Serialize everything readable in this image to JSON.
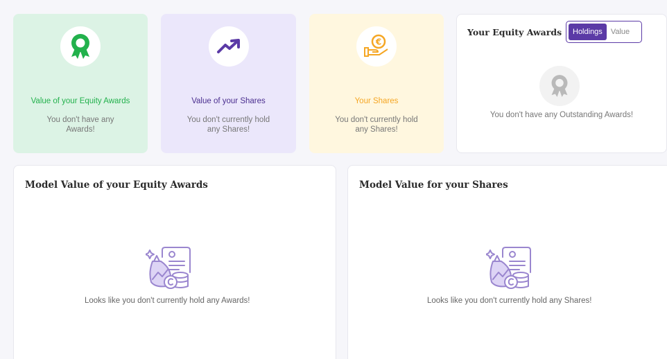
{
  "colors": {
    "green": "#22b14c",
    "purple": "#5b3aa6",
    "orange": "#f5a623",
    "grey": "#b9b9b9"
  },
  "cards": {
    "awards": {
      "title": "Value of your Equity Awards",
      "subtitle": "You don't have any Awards!",
      "icon": "ribbon-award-icon"
    },
    "shares": {
      "title": "Value of your Shares",
      "subtitle": "You don't currently hold any Shares!",
      "icon": "trending-up-icon"
    },
    "your_shares": {
      "title": "Your Shares",
      "subtitle": "You don't currently hold any Shares!",
      "icon": "hand-euro-coin-icon"
    }
  },
  "equity_awards": {
    "title": "Your Equity Awards",
    "toggle": {
      "holdings": "Holdings",
      "value": "Value",
      "selected": "Holdings"
    },
    "empty_message": "You don't have any Outstanding Awards!",
    "icon": "ribbon-award-icon"
  },
  "model_awards": {
    "title": "Model Value of your Equity Awards",
    "empty_message": "Looks like you don't currently hold any Awards!",
    "icon": "investment-illustration-icon"
  },
  "model_shares": {
    "title": "Model Value for your Shares",
    "empty_message": "Looks like you don't currently hold any Shares!",
    "icon": "investment-illustration-icon"
  }
}
